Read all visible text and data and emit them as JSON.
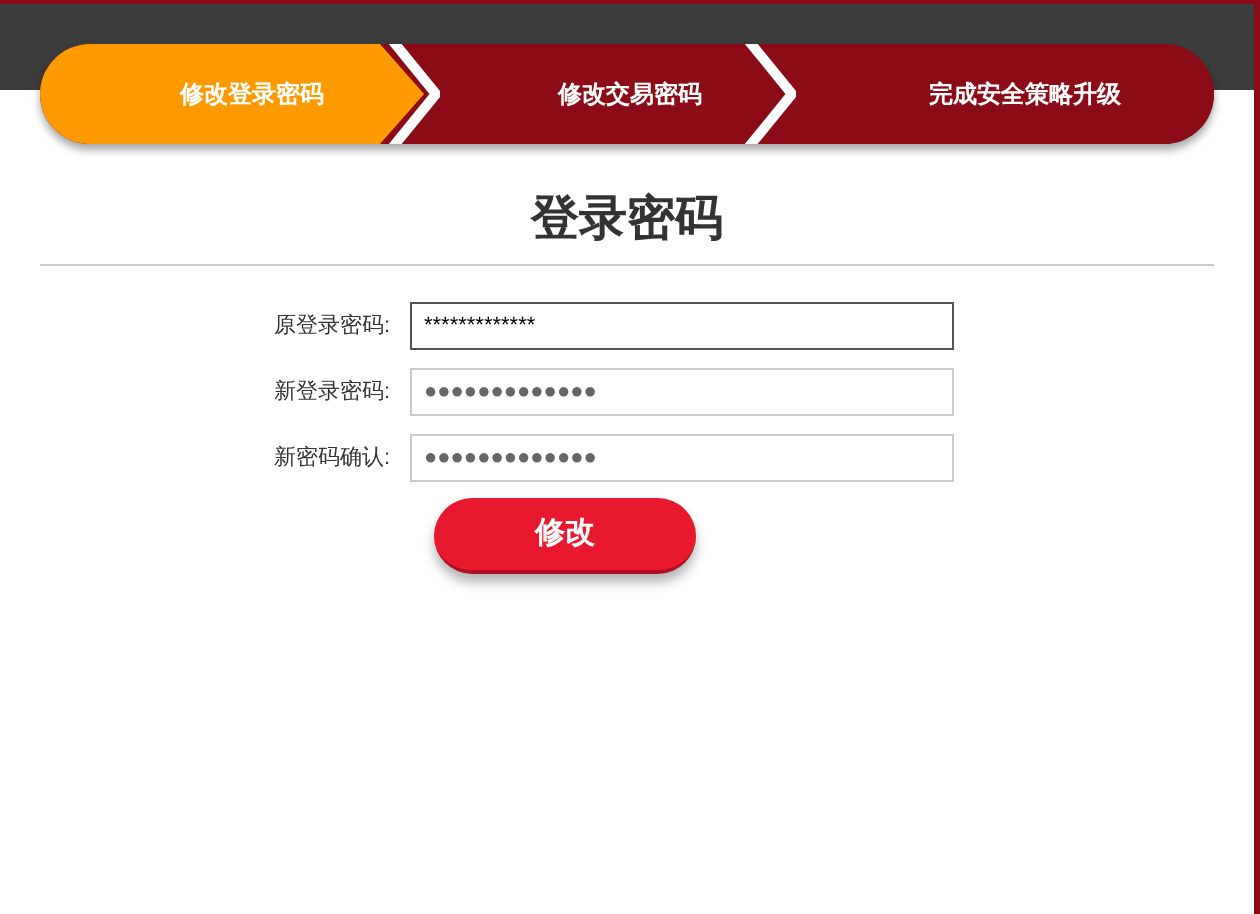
{
  "steps": [
    {
      "label": "修改登录密码",
      "selected": true
    },
    {
      "label": "修改交易密码",
      "selected": false
    },
    {
      "label": "完成安全策略升级",
      "selected": false
    }
  ],
  "title": "登录密码",
  "fields": [
    {
      "label": "原登录密码:",
      "value": "*************",
      "focused": true
    },
    {
      "label": "新登录密码:",
      "value": "●●●●●●●●●●●●●",
      "focused": false
    },
    {
      "label": "新密码确认:",
      "value": "●●●●●●●●●●●●●",
      "focused": false
    }
  ],
  "submit": "修改"
}
